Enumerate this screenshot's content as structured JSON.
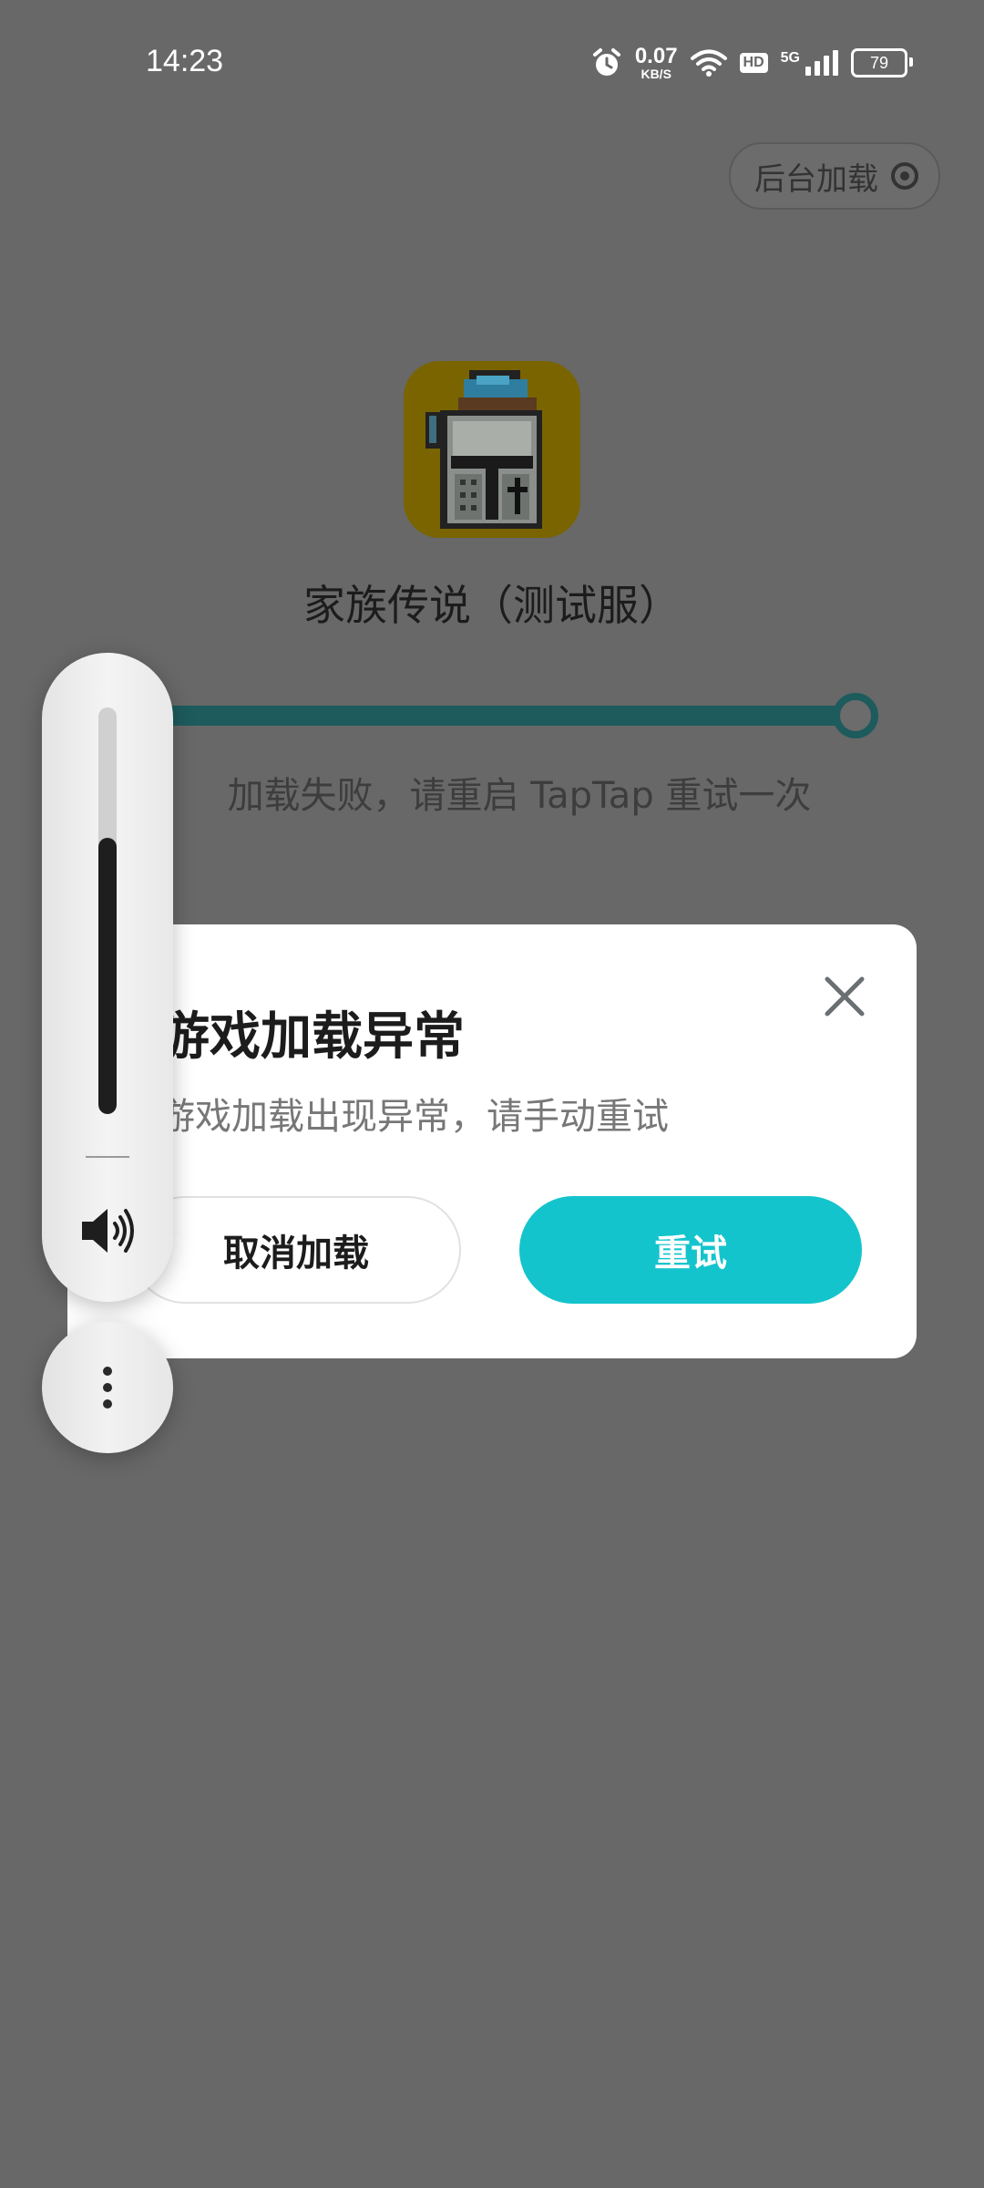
{
  "status_bar": {
    "time": "14:23",
    "net_speed_value": "0.07",
    "net_speed_unit": "KB/S",
    "hd_label": "HD",
    "network_label": "5G",
    "battery": "79",
    "icons": [
      "alarm-icon",
      "wifi-icon",
      "hd-icon",
      "signal-icon",
      "battery-icon"
    ]
  },
  "header": {
    "background_load_label": "后台加载"
  },
  "game": {
    "title": "家族传说（测试服）",
    "icon": "knight-helmet-icon"
  },
  "progress": {
    "value": 1.0,
    "message": "加载失败，请重启 TapTap 重试一次",
    "color": "#1d5b5d"
  },
  "dialog": {
    "title": "游戏加载异常",
    "message": "游戏加载出现异常，请手动重试",
    "cancel_label": "取消加载",
    "retry_label": "重试",
    "retry_color": "#14c4cc"
  },
  "volume_panel": {
    "level": 0.68,
    "icon": "speaker-icon",
    "more_icon": "more-vertical-icon"
  }
}
